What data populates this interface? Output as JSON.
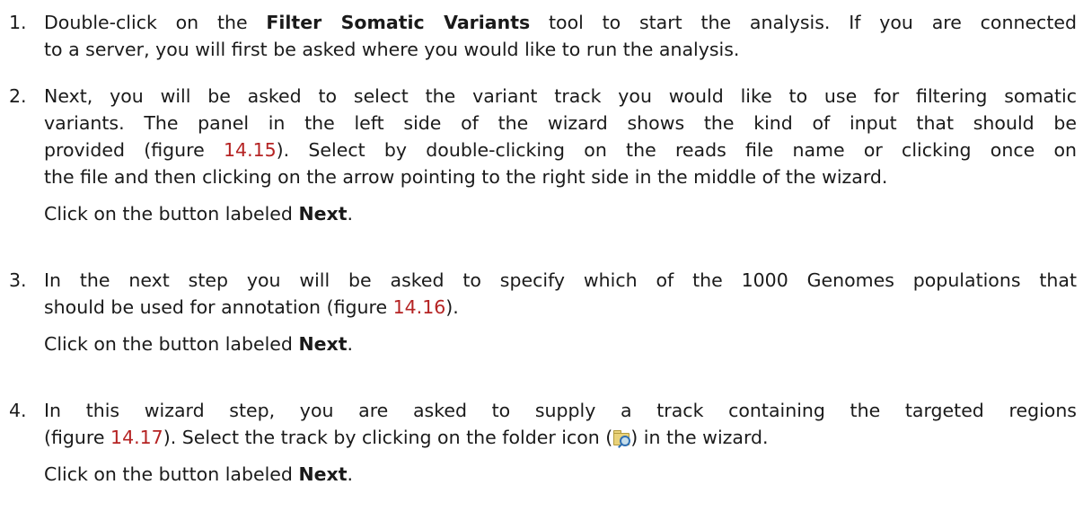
{
  "steps": [
    {
      "number": "1.",
      "line1_pre": "Double-click on the ",
      "line1_bold": "Filter Somatic Variants",
      "line1_post": " tool to start the analysis. If you are connected",
      "line2": "to a server, you will first be asked where you would like to run the analysis."
    },
    {
      "number": "2.",
      "line1": "Next, you will be asked to select the variant track you would like to use for filtering somatic",
      "line2": "variants. The panel in the left side of the wizard shows the kind of input that should be",
      "line3_pre": "provided (figure ",
      "line3_ref": "14.15",
      "line3_post": "). Select by double-clicking on the reads file name or clicking once on",
      "line4": "the file and then clicking on the arrow pointing to the right side in the middle of the wizard.",
      "next_pre": "Click on the button labeled ",
      "next_bold": "Next",
      "next_post": "."
    },
    {
      "number": "3.",
      "line1": "In the next step you will be asked to specify which of the 1000 Genomes populations that",
      "line2_pre": "should be used for annotation (figure ",
      "line2_ref": "14.16",
      "line2_post": ").",
      "next_pre": "Click on the button labeled ",
      "next_bold": "Next",
      "next_post": "."
    },
    {
      "number": "4.",
      "line1": "In this wizard step, you are asked to supply a track containing the targeted regions",
      "line2_pre": "(figure ",
      "line2_ref": "14.17",
      "line2_mid": "). Select the track by clicking on the folder icon (",
      "line2_icon": "folder-search-icon",
      "line2_post": ") in the wizard.",
      "next_pre": "Click on the button labeled ",
      "next_bold": "Next",
      "next_post": "."
    }
  ],
  "colors": {
    "text": "#1a1a1a",
    "reference": "#b52323"
  }
}
